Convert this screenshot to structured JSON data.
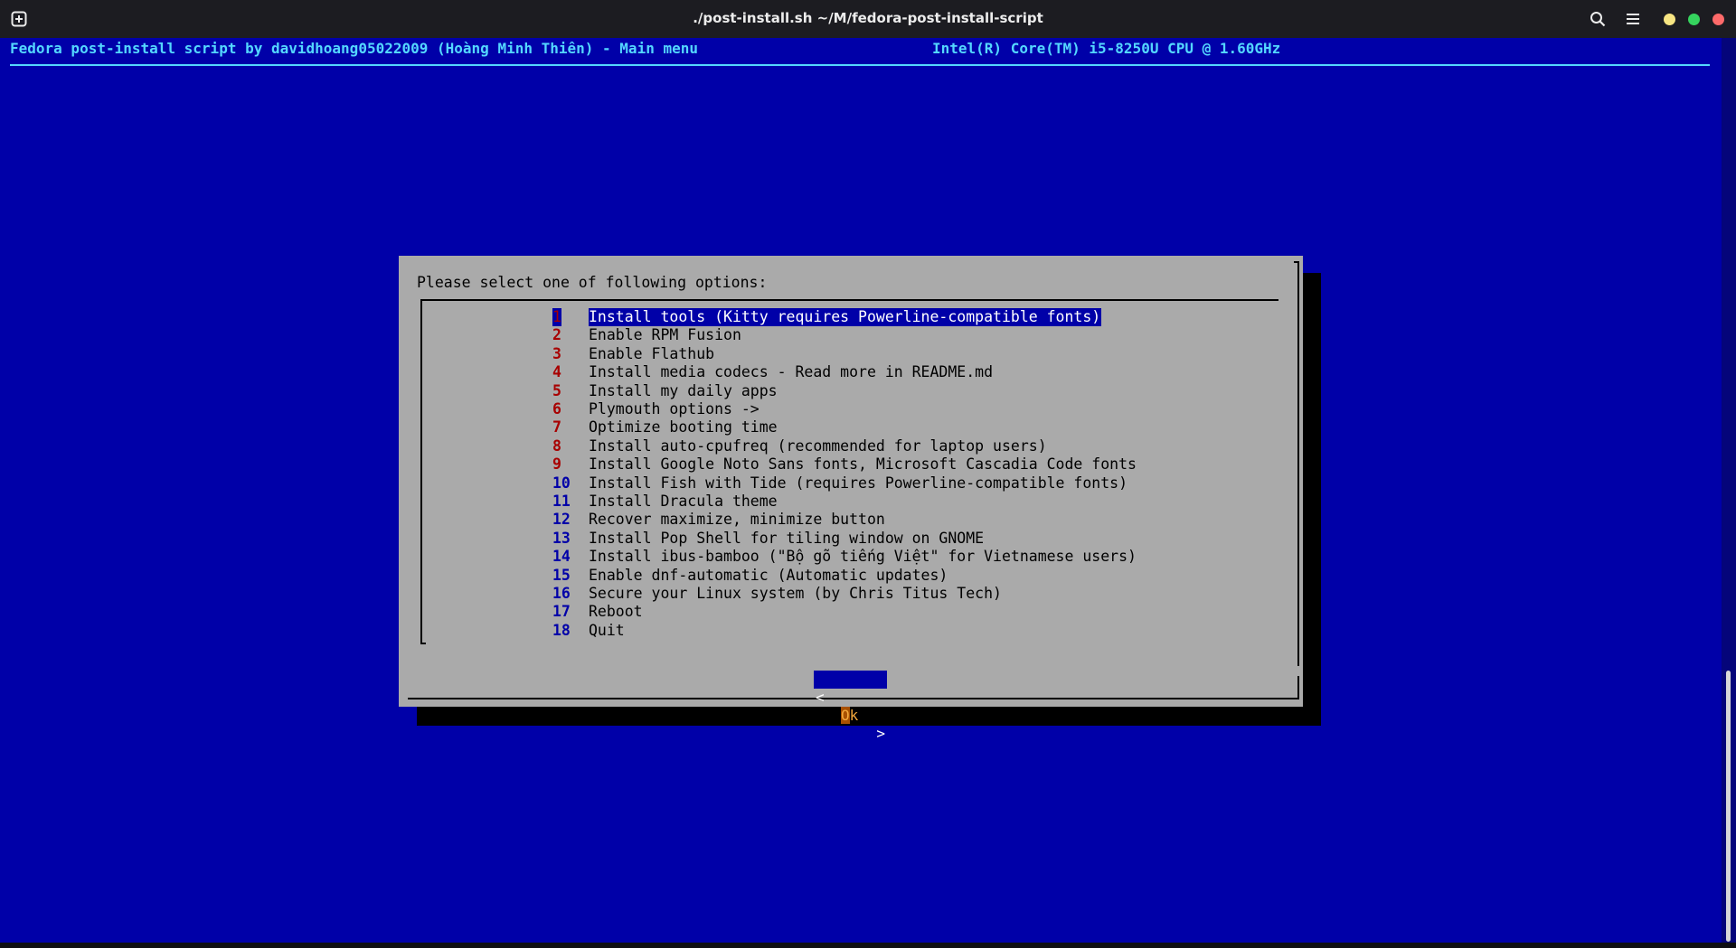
{
  "window": {
    "title": "./post-install.sh ~/M/fedora-post-install-script"
  },
  "header": {
    "left": "Fedora post-install script by davidhoang05022009 (Hoàng Minh Thiên) - Main menu",
    "right": "Intel(R) Core(TM) i5-8250U CPU @ 1.60GHz"
  },
  "dialog": {
    "prompt": "Please select one of following options:",
    "items": [
      {
        "num": "1",
        "label": "Install tools (Kitty requires Powerline-compatible fonts)"
      },
      {
        "num": "2",
        "label": "Enable RPM Fusion"
      },
      {
        "num": "3",
        "label": "Enable Flathub"
      },
      {
        "num": "4",
        "label": "Install media codecs - Read more in README.md"
      },
      {
        "num": "5",
        "label": "Install my daily apps"
      },
      {
        "num": "6",
        "label": "Plymouth options ->"
      },
      {
        "num": "7",
        "label": "Optimize booting time"
      },
      {
        "num": "8",
        "label": "Install auto-cpufreq (recommended for laptop users)"
      },
      {
        "num": "9",
        "label": "Install Google Noto Sans fonts, Microsoft Cascadia Code fonts"
      },
      {
        "num": "10",
        "label": "Install Fish with Tide (requires Powerline-compatible fonts)"
      },
      {
        "num": "11",
        "label": "Install Dracula theme"
      },
      {
        "num": "12",
        "label": "Recover maximize, minimize button"
      },
      {
        "num": "13",
        "label": "Install Pop Shell for tiling window on GNOME"
      },
      {
        "num": "14",
        "label": "Install ibus-bamboo (\"Bộ gõ tiếng Việt\" for Vietnamese users)"
      },
      {
        "num": "15",
        "label": "Enable dnf-automatic (Automatic updates)"
      },
      {
        "num": "16",
        "label": "Secure your Linux system (by Chris Titus Tech)"
      },
      {
        "num": "17",
        "label": "Reboot"
      },
      {
        "num": "18",
        "label": "Quit"
      }
    ],
    "ok": {
      "left": "<",
      "first": "O",
      "rest": "k",
      "right": ">"
    }
  },
  "colors": {
    "terminal_bg": "#0000a8",
    "dialog_bg": "#aaaaaa",
    "header_text": "#54d7ff",
    "number_red": "#a80000",
    "selection_bg": "#0000a8"
  },
  "icons": {
    "new_tab": "new-tab-icon",
    "search": "search-icon",
    "menu": "hamburger-menu-icon"
  }
}
